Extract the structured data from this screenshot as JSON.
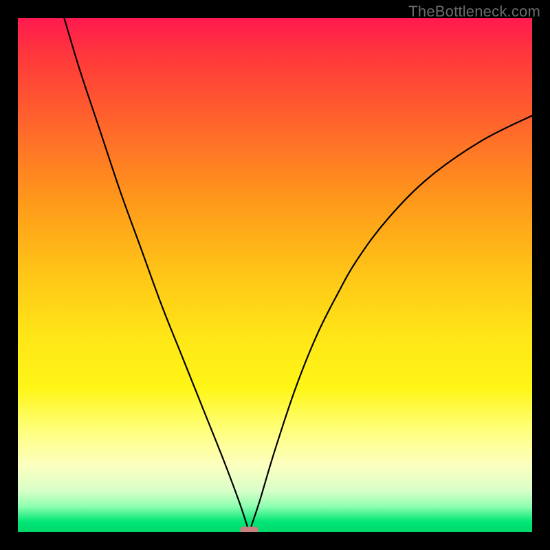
{
  "watermark": "TheBottleneck.com",
  "colors": {
    "frame": "#000000",
    "gradient_top": "#ff1a4f",
    "gradient_mid": "#ffe617",
    "gradient_bottom": "#00d86a",
    "curve": "#000000",
    "nub": "#c98080"
  },
  "chart_data": {
    "type": "line",
    "title": "",
    "xlabel": "",
    "ylabel": "",
    "xlim": [
      0,
      100
    ],
    "ylim": [
      0,
      100
    ],
    "grid": false,
    "legend": false,
    "annotations": [
      "TheBottleneck.com"
    ],
    "min_point": {
      "x": 45,
      "y": 0
    },
    "series": [
      {
        "name": "curve",
        "x": [
          9,
          12,
          16,
          20,
          24,
          28,
          32,
          36,
          40,
          43,
          44.5,
          45,
          45.5,
          47,
          50,
          54,
          58,
          62,
          66,
          72,
          80,
          90,
          100
        ],
        "y": [
          100,
          90,
          78,
          66,
          55,
          44,
          34,
          24,
          14,
          6,
          1.5,
          0,
          1.5,
          6,
          16,
          28,
          38,
          46,
          53,
          61,
          69,
          76,
          81
        ]
      }
    ],
    "background_gradient": {
      "direction": "top-to-bottom",
      "stops": [
        {
          "pos": 0.0,
          "color": "#ff1a4f"
        },
        {
          "pos": 0.5,
          "color": "#ffe617"
        },
        {
          "pos": 1.0,
          "color": "#00d86a"
        }
      ]
    }
  }
}
